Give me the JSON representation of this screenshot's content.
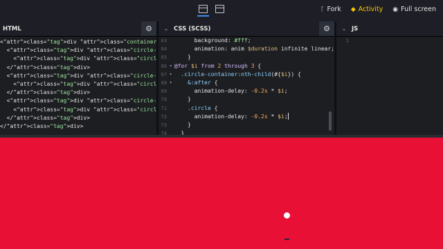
{
  "topbar": {
    "fork_label": "Fork",
    "activity_label": "Activity",
    "fullscreen_label": "Full screen"
  },
  "panes": {
    "html": {
      "title": "HTML",
      "lines": [
        "<div class=\"container\">",
        "  <div class=\"circle-container\">",
        "    <div class=\"circle\"></div>",
        "  </div>",
        "  <div class=\"circle-container\">",
        "    <div class=\"circle\"></div>",
        "  </div>",
        "  <div class=\"circle-container\">",
        "    <div class=\"circle\"></div>",
        "  </div>",
        "</div>"
      ]
    },
    "css": {
      "title": "CSS (SCSS)",
      "line_numbers": [
        "63",
        "64",
        "65",
        "66",
        "67",
        "68",
        "69",
        "70",
        "71",
        "72",
        "73",
        "74"
      ],
      "lines": [
        "      background: #fff;",
        "      animation: anim $duration infinite linear;",
        "    }",
        "@for $i from 2 through 3 {",
        "  .circle-container:nth-child(#{$i}) {",
        "    &:after {",
        "      animation-delay: -0.2s * $i;",
        "    }",
        "    .circle {",
        "      animation-delay: -0.2s * $i;",
        "    }",
        "  }"
      ]
    },
    "js": {
      "title": "JS",
      "line_numbers": [
        "1"
      ]
    }
  },
  "colors": {
    "preview_bg": "#e81034",
    "activity": "#ffc600",
    "editor_bg": "#1d1e22"
  }
}
